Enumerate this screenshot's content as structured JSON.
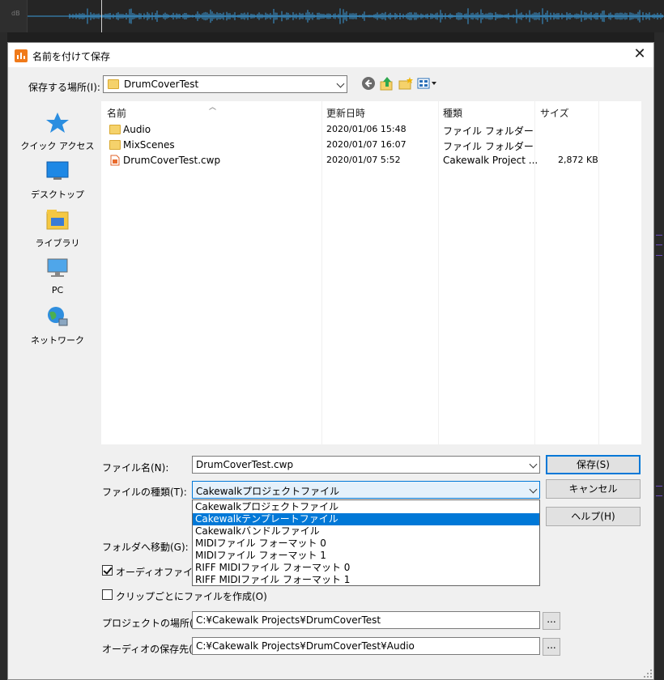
{
  "background": {
    "ruler_label": "dB"
  },
  "dialog": {
    "title": "名前を付けて保存",
    "close_glyph": "✕",
    "save_in": {
      "label": "保存する場所(I):",
      "value": "DrumCoverTest"
    },
    "toolbar": {
      "icons": [
        "back-icon",
        "up-folder-icon",
        "new-folder-icon",
        "view-menu-icon"
      ]
    },
    "places": [
      {
        "name": "quick-access",
        "label": "クイック アクセス"
      },
      {
        "name": "desktop",
        "label": "デスクトップ"
      },
      {
        "name": "libraries",
        "label": "ライブラリ"
      },
      {
        "name": "pc",
        "label": "PC"
      },
      {
        "name": "network",
        "label": "ネットワーク"
      }
    ],
    "file_list": {
      "columns": [
        "名前",
        "更新日時",
        "種類",
        "サイズ"
      ],
      "rows": [
        {
          "name": "Audio",
          "modified": "2020/01/06 15:48",
          "type": "ファイル フォルダー",
          "size": "",
          "icon": "folder-icon"
        },
        {
          "name": "MixScenes",
          "modified": "2020/01/07 16:07",
          "type": "ファイル フォルダー",
          "size": "",
          "icon": "folder-icon"
        },
        {
          "name": "DrumCoverTest.cwp",
          "modified": "2020/01/07 5:52",
          "type": "Cakewalk Project ...",
          "size": "2,872 KB",
          "icon": "cwp-file-icon"
        }
      ]
    },
    "filename": {
      "label": "ファイル名(N):",
      "value": "DrumCoverTest.cwp"
    },
    "filetype": {
      "label": "ファイルの種類(T):",
      "value": "Cakewalkプロジェクトファイル",
      "options": [
        "Cakewalkプロジェクトファイル",
        "Cakewalkテンプレートファイル",
        "Cakewalkバンドルファイル",
        "MIDIファイル フォーマット 0",
        "MIDIファイル フォーマット 1",
        "RIFF MIDIファイル フォーマット 0",
        "RIFF MIDIファイル フォーマット 1"
      ],
      "highlighted_index": 1
    },
    "buttons": {
      "save": "保存(S)",
      "cancel": "キャンセル",
      "help": "ヘルプ(H)"
    },
    "goto_folder_label": "フォルダへ移動(G):",
    "copy_audio": {
      "label": "オーディオファイルをコ",
      "checked": true
    },
    "per_clip": {
      "label": "クリップごとにファイルを作成(O)",
      "checked": false
    },
    "project_location": {
      "label": "プロジェクトの場所(E):",
      "value": "C:¥Cakewalk Projects¥DrumCoverTest"
    },
    "audio_location": {
      "label": "オーディオの保存先(A)",
      "value": "C:¥Cakewalk Projects¥DrumCoverTest¥Audio"
    },
    "browse_label": "..."
  },
  "colors": {
    "accent": "#0078d7",
    "folder": "#f5d26b",
    "waveform": "#3a9ad9",
    "app_icon": "#f07a1a"
  }
}
